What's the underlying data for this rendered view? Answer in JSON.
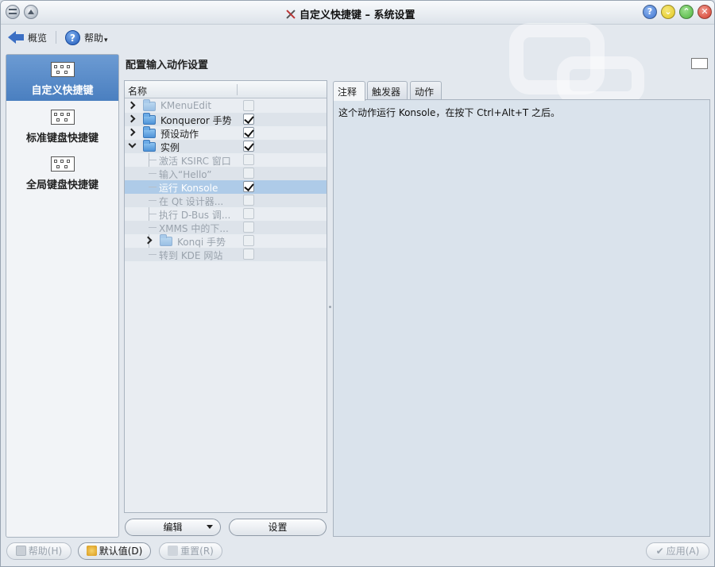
{
  "window": {
    "title": "自定义快捷键 – 系统设置",
    "colors": {
      "help_btn": "#3d74d0",
      "min_btn": "#e3c81e",
      "max_btn": "#4db33d",
      "close_btn": "#d23b2b",
      "selection": "#4a7fc0"
    }
  },
  "toolbar": {
    "overview_label": "概览",
    "help_label": "帮助"
  },
  "sidebar": {
    "items": [
      {
        "label": "自定义快捷键",
        "icon": "keyboard-icon",
        "selected": true
      },
      {
        "label": "标准键盘快捷键",
        "icon": "keyboard-icon",
        "selected": false
      },
      {
        "label": "全局键盘快捷键",
        "icon": "keyboard-icon",
        "selected": false
      }
    ]
  },
  "main": {
    "title": "配置输入动作设置"
  },
  "tree": {
    "column_name": "名称",
    "rows": [
      {
        "label": "KMenuEdit",
        "checked": false,
        "enabled": false
      },
      {
        "label": "Konqueror 手势",
        "checked": true,
        "enabled": true
      },
      {
        "label": "预设动作",
        "checked": true,
        "enabled": true
      },
      {
        "label": "实例",
        "checked": true,
        "enabled": true
      },
      {
        "label": "激活 KSIRC 窗口",
        "checked": false,
        "enabled": false
      },
      {
        "label": "输入“Hello”",
        "checked": false,
        "enabled": false
      },
      {
        "label": "运行 Konsole",
        "checked": true,
        "enabled": true
      },
      {
        "label": "在 Qt 设计器...",
        "checked": false,
        "enabled": false
      },
      {
        "label": "执行 D-Bus 调...",
        "checked": false,
        "enabled": false
      },
      {
        "label": "XMMS 中的下...",
        "checked": false,
        "enabled": false
      },
      {
        "label": "Konqi 手势",
        "checked": false,
        "enabled": false
      },
      {
        "label": "转到 KDE 网站",
        "checked": false,
        "enabled": false
      }
    ]
  },
  "tree_buttons": {
    "edit": "编辑",
    "settings": "设置"
  },
  "tabs": [
    {
      "label": "注释",
      "active": true
    },
    {
      "label": "触发器",
      "active": false
    },
    {
      "label": "动作",
      "active": false
    }
  ],
  "comment_text": "这个动作运行 Konsole，在按下 Ctrl+Alt+T 之后。",
  "footer": {
    "help": "帮助(H)",
    "defaults": "默认值(D)",
    "reset": "重置(R)",
    "apply": "应用(A)"
  }
}
